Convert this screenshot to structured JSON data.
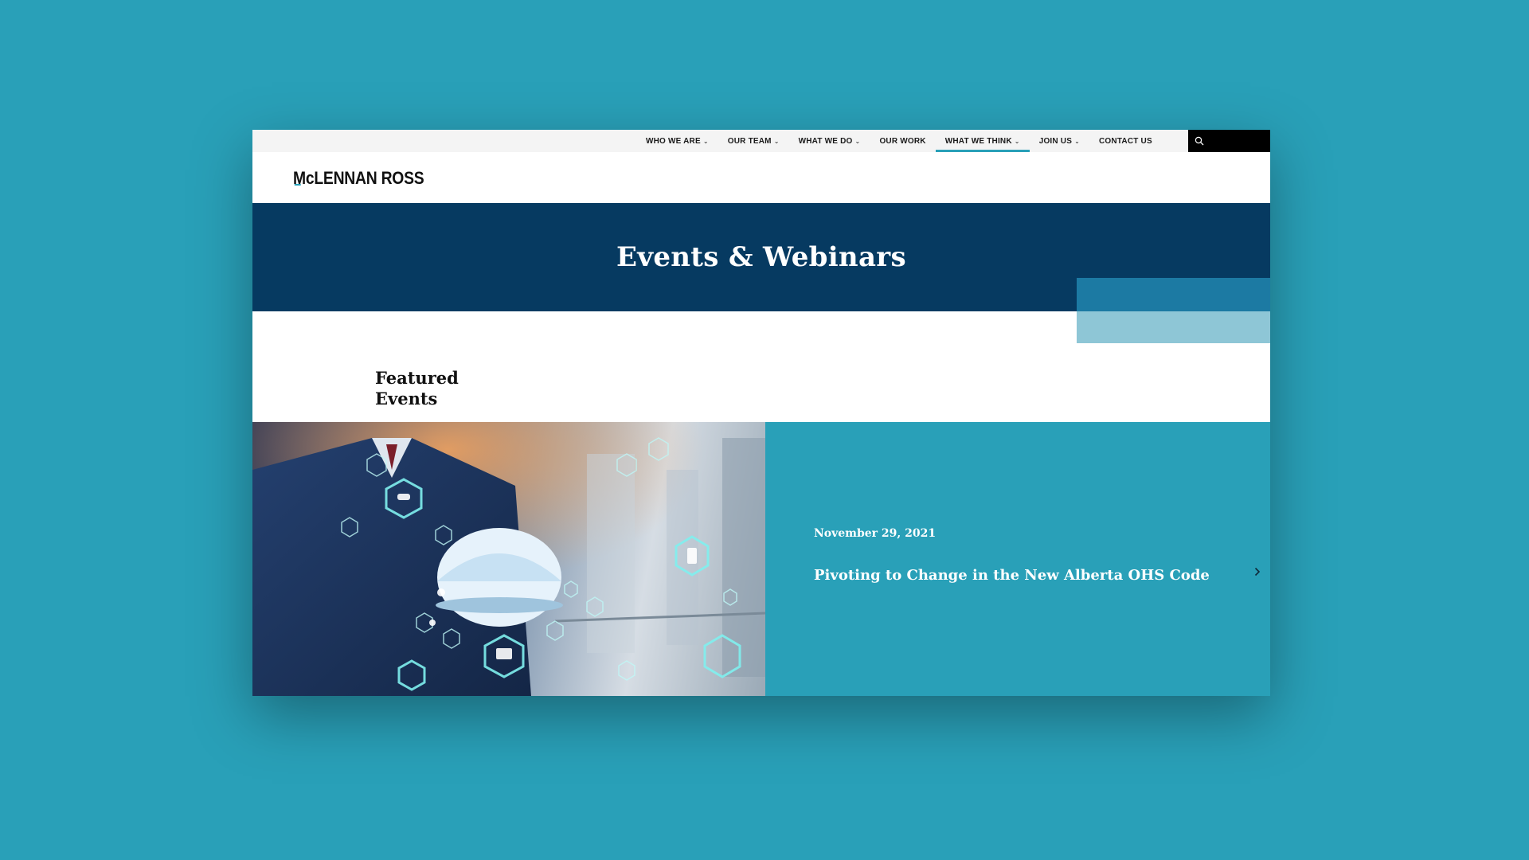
{
  "nav": {
    "items": [
      {
        "label": "WHO WE ARE",
        "has_dropdown": true,
        "active": false
      },
      {
        "label": "OUR TEAM",
        "has_dropdown": true,
        "active": false
      },
      {
        "label": "WHAT WE DO",
        "has_dropdown": true,
        "active": false
      },
      {
        "label": "OUR WORK",
        "has_dropdown": false,
        "active": false
      },
      {
        "label": "WHAT WE THINK",
        "has_dropdown": true,
        "active": true
      },
      {
        "label": "JOIN US",
        "has_dropdown": true,
        "active": false
      },
      {
        "label": "CONTACT US",
        "has_dropdown": false,
        "active": false
      }
    ],
    "chevron": "⌄",
    "search_icon": "search-icon"
  },
  "logo": {
    "text": "McLENNAN ROSS",
    "prefix": "Mc",
    "rest": "LENNAN ROSS"
  },
  "hero": {
    "title": "Events & Webinars"
  },
  "featured": {
    "heading": "Featured Events",
    "event": {
      "date": "November 29, 2021",
      "title": "Pivoting to Change in the New Alberta OHS Code"
    },
    "next_icon": "chevron-right-icon"
  },
  "colors": {
    "background": "#29a0b8",
    "navy": "#063a61",
    "accent": "#29a0b8",
    "deco_dark": "#1c7aa3",
    "deco_light": "#8ec6d6"
  }
}
